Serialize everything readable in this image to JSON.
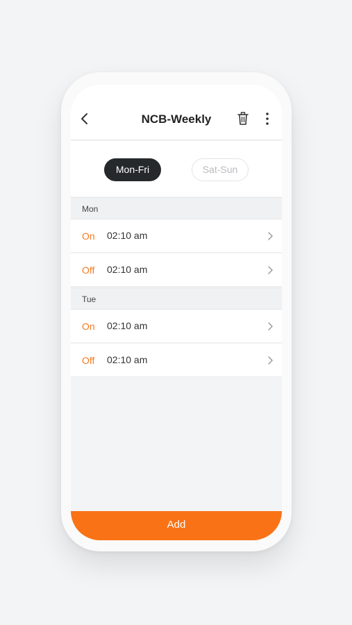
{
  "header": {
    "title": "NCB-Weekly",
    "icons": [
      "back-icon",
      "trash-icon",
      "more-vertical-icon"
    ]
  },
  "segments": {
    "active": "Mon-Fri",
    "inactive": "Sat-Sun"
  },
  "days": [
    {
      "label": "Mon",
      "entries": [
        {
          "state": "On",
          "time": "02:10 am"
        },
        {
          "state": "Off",
          "time": "02:10 am"
        }
      ]
    },
    {
      "label": "Tue",
      "entries": [
        {
          "state": "On",
          "time": "02:10 am"
        },
        {
          "state": "Off",
          "time": "02:10 am"
        }
      ]
    }
  ],
  "footer": {
    "add_label": "Add"
  },
  "colors": {
    "accent": "#f97316",
    "state_text": "#f47a20",
    "active_segment": "#26292c"
  }
}
